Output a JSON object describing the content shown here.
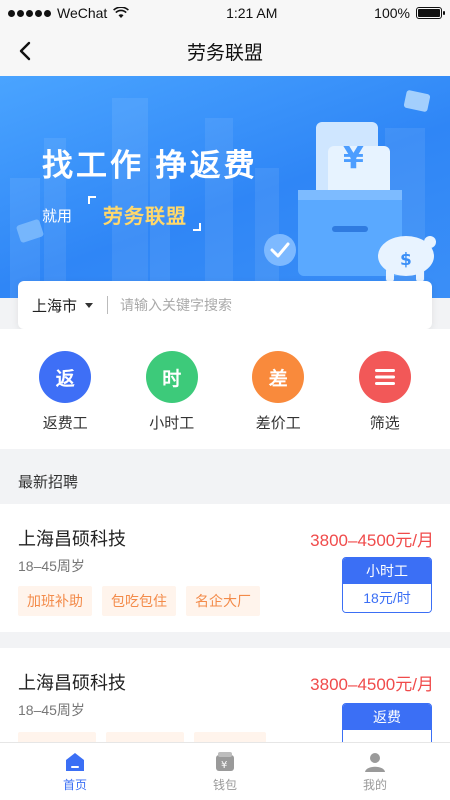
{
  "status_bar": {
    "carrier": "WeChat",
    "time": "1:21 AM",
    "battery": "100%",
    "battery_level": 1.0
  },
  "nav": {
    "title": "劳务联盟"
  },
  "banner": {
    "headline": "找工作  挣返费",
    "sub_prefix": "就用",
    "brand": "劳务联盟",
    "money_symbol": "¥",
    "pig_symbol": "$"
  },
  "search": {
    "city": "上海市",
    "placeholder": "请输入关键字搜索"
  },
  "categories": [
    {
      "glyph": "返",
      "label": "返费工",
      "color": "#3e6ff6"
    },
    {
      "glyph": "时",
      "label": "小时工",
      "color": "#3dca7a"
    },
    {
      "glyph": "差",
      "label": "差价工",
      "color": "#f98a3c"
    },
    {
      "glyph": "≡",
      "label": "筛选",
      "color": "#f25858"
    }
  ],
  "section": {
    "title": "最新招聘"
  },
  "jobs": [
    {
      "company": "上海昌硕科技",
      "salary": "3800–4500元/月",
      "age": "18–45周岁",
      "tags": [
        "加班补助",
        "包吃包住",
        "名企大厂"
      ],
      "type": "小时工",
      "type_detail": "18元/时"
    },
    {
      "company": "上海昌硕科技",
      "salary": "3800–4500元/月",
      "age": "18–45周岁",
      "tags": [
        "",
        "",
        ""
      ],
      "type": "返费",
      "type_detail": ""
    }
  ],
  "tab_bar": [
    {
      "label": "首页",
      "icon": "home-icon",
      "active": true
    },
    {
      "label": "钱包",
      "icon": "wallet-icon",
      "active": false
    },
    {
      "label": "我的",
      "icon": "profile-icon",
      "active": false
    }
  ],
  "colors": {
    "accent": "#3b6ff5",
    "salary": "#f04b4b",
    "tag_text": "#f38b4a",
    "banner": "#2f86f6"
  }
}
